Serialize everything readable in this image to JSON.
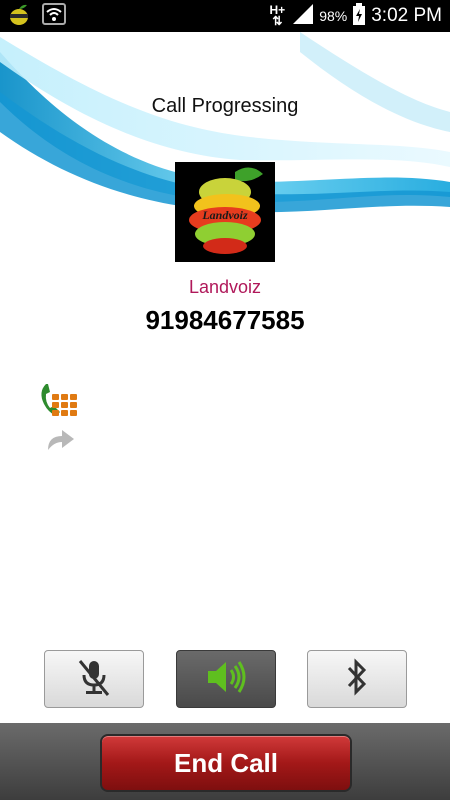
{
  "status_bar": {
    "network_type": "H+",
    "battery_percent": "98%",
    "time": "3:02 PM",
    "icons": [
      "app-fruit-icon",
      "wifi-icon",
      "signal-icon",
      "battery-charging-icon"
    ]
  },
  "header": {
    "title": "Call Progressing"
  },
  "contact": {
    "photo_label": "Landvoiz",
    "name": "Landvoiz",
    "number": "91984677585"
  },
  "side_actions": {
    "icons": [
      "dialpad-icon",
      "forward-icon"
    ]
  },
  "controls": {
    "mute": {
      "icon": "mic-muted-icon",
      "active": false
    },
    "speaker": {
      "icon": "speaker-icon",
      "active": true
    },
    "bluetooth": {
      "icon": "bluetooth-icon",
      "active": false
    }
  },
  "end_call": {
    "label": "End Call"
  },
  "colors": {
    "name_color": "#b0185a",
    "end_call": "#a31818",
    "speaker_icon": "#5fbf1f",
    "swoosh": "#1ea9de"
  }
}
